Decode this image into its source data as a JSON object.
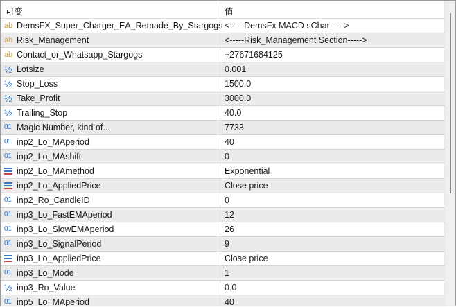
{
  "header": {
    "col_name": "可变",
    "col_value": "值"
  },
  "rows": [
    {
      "icon": "string",
      "name": "DemsFX_Super_Charger_EA_Remade_By_Stargogs",
      "value": "<-----DemsFx MACD sChar----->"
    },
    {
      "icon": "string",
      "name": "Risk_Management",
      "value": "<-----Risk_Management Section----->"
    },
    {
      "icon": "string",
      "name": "Contact_or_Whatsapp_Stargogs",
      "value": "+27671684125"
    },
    {
      "icon": "double",
      "name": "Lotsize",
      "value": "0.001"
    },
    {
      "icon": "double",
      "name": "Stop_Loss",
      "value": "1500.0"
    },
    {
      "icon": "double",
      "name": "Take_Profit",
      "value": "3000.0"
    },
    {
      "icon": "double",
      "name": "Trailing_Stop",
      "value": "40.0"
    },
    {
      "icon": "integer",
      "name": "Magic Number, kind of...",
      "value": "7733"
    },
    {
      "icon": "integer",
      "name": "inp2_Lo_MAperiod",
      "value": "40"
    },
    {
      "icon": "integer",
      "name": "inp2_Lo_MAshift",
      "value": "0"
    },
    {
      "icon": "enum",
      "name": "inp2_Lo_MAmethod",
      "value": "Exponential"
    },
    {
      "icon": "enum",
      "name": "inp2_Lo_AppliedPrice",
      "value": "Close price"
    },
    {
      "icon": "integer",
      "name": "inp2_Ro_CandleID",
      "value": "0"
    },
    {
      "icon": "integer",
      "name": "inp3_Lo_FastEMAperiod",
      "value": "12"
    },
    {
      "icon": "integer",
      "name": "inp3_Lo_SlowEMAperiod",
      "value": "26"
    },
    {
      "icon": "integer",
      "name": "inp3_Lo_SignalPeriod",
      "value": "9"
    },
    {
      "icon": "enum",
      "name": "inp3_Lo_AppliedPrice",
      "value": "Close price"
    },
    {
      "icon": "integer",
      "name": "inp3_Lo_Mode",
      "value": "1"
    },
    {
      "icon": "double",
      "name": "inp3_Ro_Value",
      "value": "0.0"
    },
    {
      "icon": "integer",
      "name": "inp5_Lo_MAperiod",
      "value": "40"
    }
  ],
  "icon_glyphs": {
    "string": "ab",
    "double": "½",
    "integer": "01",
    "enum": ""
  }
}
